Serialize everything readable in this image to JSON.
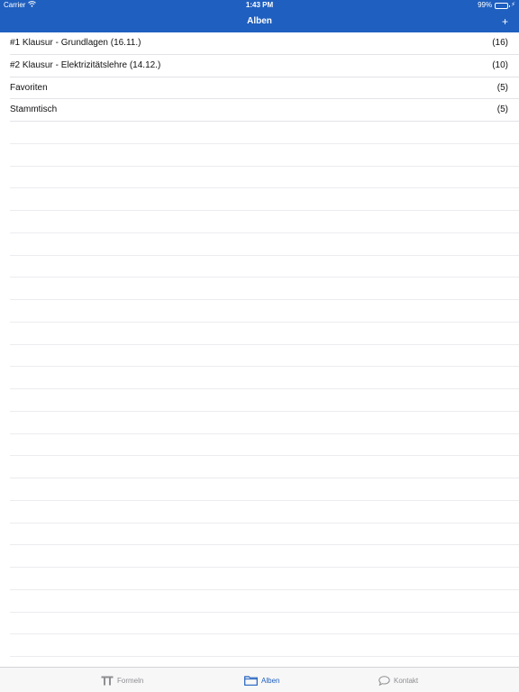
{
  "status_bar": {
    "carrier": "Carrier",
    "time": "1:43 PM",
    "battery": "99%",
    "battery_level": 0.99
  },
  "nav": {
    "title": "Alben",
    "add_label": "+"
  },
  "albums": [
    {
      "name": "#1 Klausur - Grundlagen (16.11.)",
      "count": "(16)"
    },
    {
      "name": "#2 Klausur - Elektrizitätslehre (14.12.)",
      "count": "(10)"
    },
    {
      "name": "Favoriten",
      "count": "(5)"
    },
    {
      "name": "Stammtisch",
      "count": "(5)"
    }
  ],
  "tabs": [
    {
      "label": "Formeln",
      "icon": "pi-icon",
      "active": false
    },
    {
      "label": "Alben",
      "icon": "folder-icon",
      "active": true
    },
    {
      "label": "Kontakt",
      "icon": "speech-bubble-icon",
      "active": false
    }
  ],
  "colors": {
    "accent": "#1f5fbf",
    "inactive_tab": "#8e8e93",
    "separator": "#e3e3e8",
    "battery_fill": "#6fe36f"
  }
}
